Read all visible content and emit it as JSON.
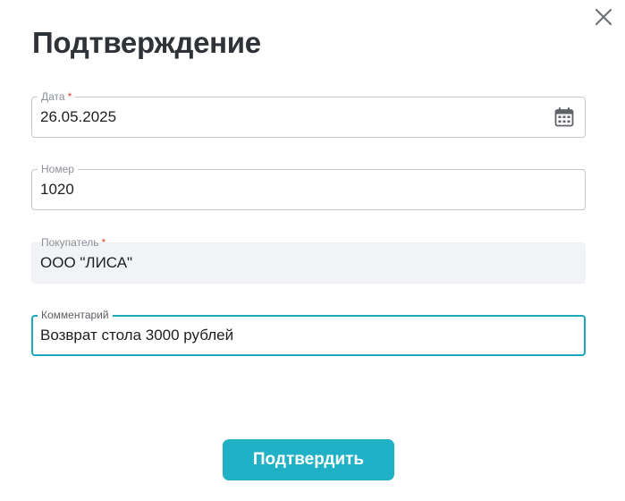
{
  "dialog": {
    "title": "Подтверждение",
    "close_icon": "close-icon"
  },
  "fields": {
    "date": {
      "label": "Дата",
      "required_mark": "*",
      "value": "26.05.2025",
      "icon": "calendar-icon"
    },
    "number": {
      "label": "Номер",
      "value": "1020"
    },
    "buyer": {
      "label": "Покупатель",
      "required_mark": "*",
      "value": "ООО \"ЛИСА\"",
      "disabled": true
    },
    "comment": {
      "label": "Комментарий",
      "value": "Возврат стола 3000 рублей",
      "focused": true
    }
  },
  "actions": {
    "confirm_label": "Подтвердить"
  },
  "colors": {
    "accent": "#20b1c7",
    "focus_border": "#1aa8bf",
    "required": "#e0442c",
    "title": "#2f3337",
    "disabled_bg": "#f1f3f6"
  }
}
